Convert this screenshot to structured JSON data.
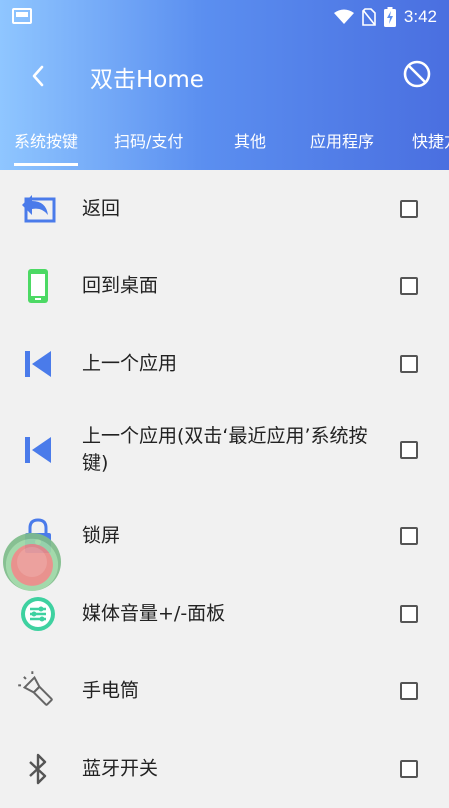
{
  "status_bar": {
    "time": "3:42"
  },
  "header": {
    "title": "双击Home"
  },
  "tabs": [
    {
      "label": "系统按键",
      "active": true
    },
    {
      "label": "扫码/支付",
      "active": false
    },
    {
      "label": "其他",
      "active": false
    },
    {
      "label": "应用程序",
      "active": false
    },
    {
      "label": "快捷方",
      "active": false
    }
  ],
  "items": [
    {
      "label": "返回",
      "icon": "back-arrow-icon",
      "checked": false
    },
    {
      "label": "回到桌面",
      "icon": "phone-home-icon",
      "checked": false
    },
    {
      "label": "上一个应用",
      "icon": "skip-previous-icon",
      "checked": false
    },
    {
      "label": "上一个应用(双击‘最近应用’系统按键)",
      "icon": "skip-previous-icon",
      "checked": false
    },
    {
      "label": "锁屏",
      "icon": "lock-icon",
      "checked": false
    },
    {
      "label": "媒体音量+/-面板",
      "icon": "volume-panel-icon",
      "checked": false
    },
    {
      "label": "手电筒",
      "icon": "flashlight-icon",
      "checked": false
    },
    {
      "label": "蓝牙开关",
      "icon": "bluetooth-icon",
      "checked": false
    }
  ],
  "colors": {
    "accent": "#5b8ff0",
    "icon_blue": "#4a7bea",
    "icon_green": "#4cd964"
  }
}
